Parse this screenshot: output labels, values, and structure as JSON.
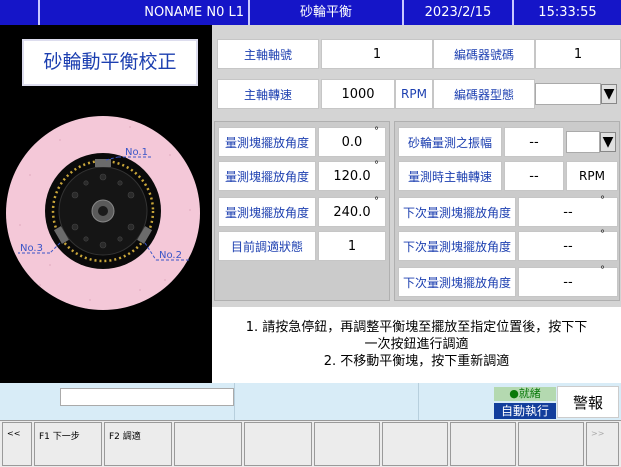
{
  "topbar": {
    "program": "NONAME N0 L1",
    "screen_title": "砂輪平衡",
    "date": "2023/2/15",
    "time": "15:33:55"
  },
  "left": {
    "title": "砂輪動平衡校正",
    "markers": [
      "No.1",
      "No.2",
      "No.3"
    ]
  },
  "spindle": {
    "number_label": "主軸軸號",
    "number_value": "1",
    "speed_label": "主軸轉速",
    "speed_value": "1000",
    "speed_unit": "RPM"
  },
  "encoder": {
    "number_label": "編碼器號碼",
    "number_value": "1",
    "type_label": "編碼器型態",
    "type_value": ""
  },
  "blocks": {
    "rows": [
      {
        "label": "量測塊擺放角度",
        "value": "0.0"
      },
      {
        "label": "量測塊擺放角度",
        "value": "120.0"
      },
      {
        "label": "量測塊擺放角度",
        "value": "240.0"
      }
    ],
    "deg_symbol": "°",
    "status_label": "目前調適狀態",
    "status_value": "1"
  },
  "measure": {
    "amplitude_label": "砂輪量測之振幅",
    "amplitude_value": "--",
    "amplitude_unit": "",
    "speed_label": "量測時主軸轉速",
    "speed_value": "--",
    "speed_unit": "RPM",
    "next_rows": [
      {
        "label": "下次量測塊擺放角度",
        "value": "--"
      },
      {
        "label": "下次量測塊擺放角度",
        "value": "--"
      },
      {
        "label": "下次量測塊擺放角度",
        "value": "--"
      }
    ]
  },
  "instructions": {
    "line1": "1. 請按急停鈕，再調整平衡塊至擺放至指定位置後，按下下",
    "line2": "一次按鈕進行調適",
    "line3": "2. 不移動平衡塊，按下重新調適"
  },
  "status": {
    "message": "",
    "ready": "●就緒",
    "auto": "自動執行",
    "alarm": "警報"
  },
  "softkeys": {
    "prev": "<<",
    "f1": "F1 下一步",
    "f2": "F2 調適",
    "next": ">>"
  },
  "icons": {
    "dropdown": "triangle-down-icon"
  },
  "colors": {
    "topbar": "#1515c8",
    "label_text": "#1c3fb0",
    "wheel": "#f4c8d8",
    "status_bg": "#d8ecf7",
    "auto_badge": "#123e9c"
  }
}
